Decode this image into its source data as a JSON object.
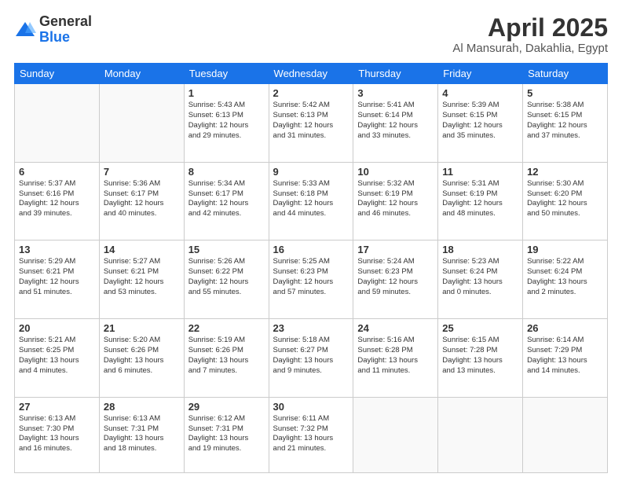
{
  "logo": {
    "general": "General",
    "blue": "Blue"
  },
  "header": {
    "title": "April 2025",
    "subtitle": "Al Mansurah, Dakahlia, Egypt"
  },
  "weekdays": [
    "Sunday",
    "Monday",
    "Tuesday",
    "Wednesday",
    "Thursday",
    "Friday",
    "Saturday"
  ],
  "weeks": [
    [
      {
        "day": "",
        "info": ""
      },
      {
        "day": "",
        "info": ""
      },
      {
        "day": "1",
        "info": "Sunrise: 5:43 AM\nSunset: 6:13 PM\nDaylight: 12 hours\nand 29 minutes."
      },
      {
        "day": "2",
        "info": "Sunrise: 5:42 AM\nSunset: 6:13 PM\nDaylight: 12 hours\nand 31 minutes."
      },
      {
        "day": "3",
        "info": "Sunrise: 5:41 AM\nSunset: 6:14 PM\nDaylight: 12 hours\nand 33 minutes."
      },
      {
        "day": "4",
        "info": "Sunrise: 5:39 AM\nSunset: 6:15 PM\nDaylight: 12 hours\nand 35 minutes."
      },
      {
        "day": "5",
        "info": "Sunrise: 5:38 AM\nSunset: 6:15 PM\nDaylight: 12 hours\nand 37 minutes."
      }
    ],
    [
      {
        "day": "6",
        "info": "Sunrise: 5:37 AM\nSunset: 6:16 PM\nDaylight: 12 hours\nand 39 minutes."
      },
      {
        "day": "7",
        "info": "Sunrise: 5:36 AM\nSunset: 6:17 PM\nDaylight: 12 hours\nand 40 minutes."
      },
      {
        "day": "8",
        "info": "Sunrise: 5:34 AM\nSunset: 6:17 PM\nDaylight: 12 hours\nand 42 minutes."
      },
      {
        "day": "9",
        "info": "Sunrise: 5:33 AM\nSunset: 6:18 PM\nDaylight: 12 hours\nand 44 minutes."
      },
      {
        "day": "10",
        "info": "Sunrise: 5:32 AM\nSunset: 6:19 PM\nDaylight: 12 hours\nand 46 minutes."
      },
      {
        "day": "11",
        "info": "Sunrise: 5:31 AM\nSunset: 6:19 PM\nDaylight: 12 hours\nand 48 minutes."
      },
      {
        "day": "12",
        "info": "Sunrise: 5:30 AM\nSunset: 6:20 PM\nDaylight: 12 hours\nand 50 minutes."
      }
    ],
    [
      {
        "day": "13",
        "info": "Sunrise: 5:29 AM\nSunset: 6:21 PM\nDaylight: 12 hours\nand 51 minutes."
      },
      {
        "day": "14",
        "info": "Sunrise: 5:27 AM\nSunset: 6:21 PM\nDaylight: 12 hours\nand 53 minutes."
      },
      {
        "day": "15",
        "info": "Sunrise: 5:26 AM\nSunset: 6:22 PM\nDaylight: 12 hours\nand 55 minutes."
      },
      {
        "day": "16",
        "info": "Sunrise: 5:25 AM\nSunset: 6:23 PM\nDaylight: 12 hours\nand 57 minutes."
      },
      {
        "day": "17",
        "info": "Sunrise: 5:24 AM\nSunset: 6:23 PM\nDaylight: 12 hours\nand 59 minutes."
      },
      {
        "day": "18",
        "info": "Sunrise: 5:23 AM\nSunset: 6:24 PM\nDaylight: 13 hours\nand 0 minutes."
      },
      {
        "day": "19",
        "info": "Sunrise: 5:22 AM\nSunset: 6:24 PM\nDaylight: 13 hours\nand 2 minutes."
      }
    ],
    [
      {
        "day": "20",
        "info": "Sunrise: 5:21 AM\nSunset: 6:25 PM\nDaylight: 13 hours\nand 4 minutes."
      },
      {
        "day": "21",
        "info": "Sunrise: 5:20 AM\nSunset: 6:26 PM\nDaylight: 13 hours\nand 6 minutes."
      },
      {
        "day": "22",
        "info": "Sunrise: 5:19 AM\nSunset: 6:26 PM\nDaylight: 13 hours\nand 7 minutes."
      },
      {
        "day": "23",
        "info": "Sunrise: 5:18 AM\nSunset: 6:27 PM\nDaylight: 13 hours\nand 9 minutes."
      },
      {
        "day": "24",
        "info": "Sunrise: 5:16 AM\nSunset: 6:28 PM\nDaylight: 13 hours\nand 11 minutes."
      },
      {
        "day": "25",
        "info": "Sunrise: 6:15 AM\nSunset: 7:28 PM\nDaylight: 13 hours\nand 13 minutes."
      },
      {
        "day": "26",
        "info": "Sunrise: 6:14 AM\nSunset: 7:29 PM\nDaylight: 13 hours\nand 14 minutes."
      }
    ],
    [
      {
        "day": "27",
        "info": "Sunrise: 6:13 AM\nSunset: 7:30 PM\nDaylight: 13 hours\nand 16 minutes."
      },
      {
        "day": "28",
        "info": "Sunrise: 6:13 AM\nSunset: 7:31 PM\nDaylight: 13 hours\nand 18 minutes."
      },
      {
        "day": "29",
        "info": "Sunrise: 6:12 AM\nSunset: 7:31 PM\nDaylight: 13 hours\nand 19 minutes."
      },
      {
        "day": "30",
        "info": "Sunrise: 6:11 AM\nSunset: 7:32 PM\nDaylight: 13 hours\nand 21 minutes."
      },
      {
        "day": "",
        "info": ""
      },
      {
        "day": "",
        "info": ""
      },
      {
        "day": "",
        "info": ""
      }
    ]
  ]
}
